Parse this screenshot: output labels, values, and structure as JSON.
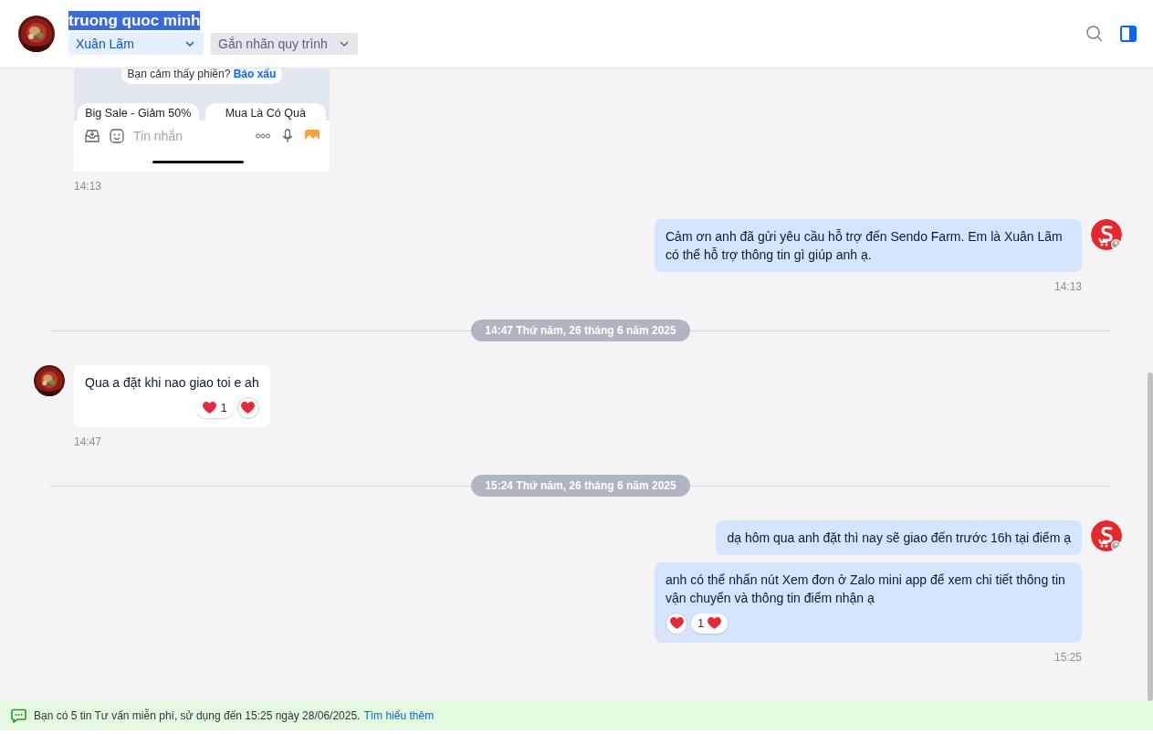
{
  "header": {
    "name": "truong quoc minh",
    "name_highlighted": true,
    "assignee": "Xuân Lãm",
    "label_select": "Gắn nhãn quy trình",
    "panel_open": true
  },
  "messages": [
    {
      "kind": "screenshot",
      "screenshot": {
        "notice": "Bạn cảm thấy phiền?",
        "report_link": "Báo xấu",
        "chips": [
          "Big Sale - Giảm 50%",
          "Mua Là Có Quà"
        ],
        "placeholder": "Tin nhắn"
      },
      "time": "14:13"
    },
    {
      "kind": "text",
      "outgoing": true,
      "bubbles": [
        {
          "text": "Cảm ơn anh đã gửi yêu cầu hỗ trợ đến Sendo Farm. Em là Xuân Lãm có thể hỗ trợ thông tin gì giúp anh ạ."
        }
      ],
      "time": "14:13"
    },
    {
      "kind": "divider",
      "label": "14:47 Thứ năm, 26 tháng 6 năm 2025"
    },
    {
      "kind": "text",
      "outgoing": false,
      "bubbles": [
        {
          "text": "Qua a đặt khi nao giao toi e ah",
          "reaction_count": "1"
        }
      ],
      "time": "14:47"
    },
    {
      "kind": "divider",
      "label": "15:24 Thứ năm, 26 tháng 6 năm 2025"
    },
    {
      "kind": "text",
      "outgoing": true,
      "bubbles": [
        {
          "text": "dạ hôm qua anh đặt thì nay sẽ giao đến trước 16h tại điểm ạ"
        },
        {
          "text": "anh có thể nhấn nút Xem đơn ở Zalo mini app để xem chi tiết thông tin vận chuyển và thông tin điểm nhận ạ",
          "reaction_count": "1"
        }
      ],
      "time": "15:25"
    }
  ],
  "banner": {
    "text": "Bạn có 5 tin Tư vấn miễn phí, sử dụng đến 15:25 ngày 28/06/2025.",
    "link": "Tìm hiểu thêm"
  }
}
